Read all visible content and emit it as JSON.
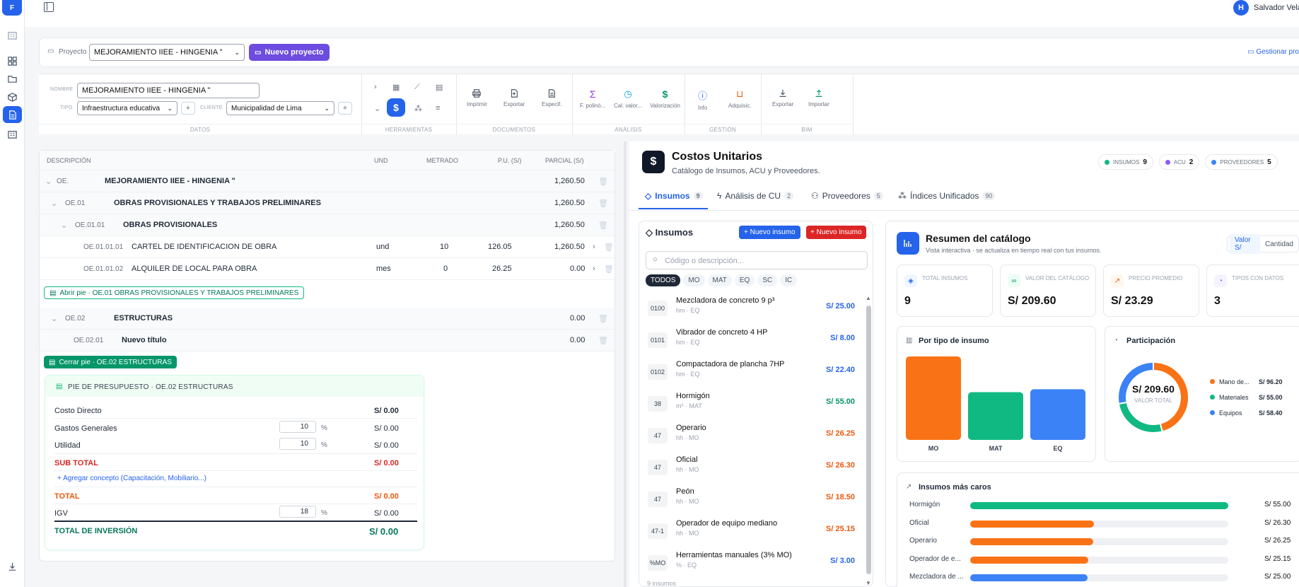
{
  "app": {
    "logo": "F",
    "user": "Salvador Velasquez"
  },
  "project": {
    "label": "Proyecto",
    "selected": "MEJORAMIENTO IIEE - HINGENIA \"",
    "new_button": "Nuevo proyecto",
    "manage_link": "Gestionar pro"
  },
  "datos": {
    "nombre_label": "NOMBRE",
    "nombre_value": "MEJORAMIENTO IIEE - HINGENIA \"",
    "tipo_label": "TIPO",
    "tipo_value": "Infraestructura educativa",
    "cliente_label": "CLIENTE",
    "cliente_value": "Municipalidad de Lima"
  },
  "sections": {
    "datos": "DATOS",
    "herramientas": "HERRAMIENTAS",
    "documentos": "DOCUMENTOS",
    "analisis": "ANÁLISIS",
    "gestion": "GESTIÓN",
    "bim": "BIM"
  },
  "tools": {
    "imprimir": "Imprimir",
    "exportar": "Exportar",
    "especif": "Especif.",
    "polinomica": "F. polinó...",
    "calvalor": "Cal. valor...",
    "valorizacion": "Valorización",
    "info": "Info",
    "adquisic": "Adquisic.",
    "bim_exportar": "Exportar",
    "bim_importar": "Importar"
  },
  "table": {
    "headers": {
      "desc": "DESCRIPCIÓN",
      "und": "UND",
      "metrado": "METRADO",
      "pu": "P.U. (S/)",
      "parcial": "PARCIAL (S/)"
    },
    "rows": [
      {
        "code": "OE.",
        "desc": "MEJORAMIENTO IIEE - HINGENIA \"",
        "und": "",
        "metrado": "",
        "pu": "",
        "parcial": "1,260.50"
      },
      {
        "code": "OE.01",
        "desc": "OBRAS PROVISIONALES Y TRABAJOS PRELIMINARES",
        "und": "",
        "metrado": "",
        "pu": "",
        "parcial": "1,260.50"
      },
      {
        "code": "OE.01.01",
        "desc": "OBRAS PROVISIONALES",
        "und": "",
        "metrado": "",
        "pu": "",
        "parcial": "1,260.50"
      },
      {
        "code": "OE.01.01.01",
        "desc": "CARTEL DE IDENTIFICACION DE OBRA",
        "und": "und",
        "metrado": "10",
        "pu": "126.05",
        "parcial": "1,260.50"
      },
      {
        "code": "OE.01.01.02",
        "desc": "ALQUILER DE LOCAL PARA OBRA",
        "und": "mes",
        "metrado": "0",
        "pu": "26.25",
        "parcial": "0.00"
      },
      {
        "code": "OE.02",
        "desc": "ESTRUCTURAS",
        "und": "",
        "metrado": "",
        "pu": "",
        "parcial": "0.00"
      },
      {
        "code": "OE.02.01",
        "desc": "Nuevo título",
        "und": "",
        "metrado": "",
        "pu": "",
        "parcial": "0.00"
      }
    ],
    "open_pie": "Abrir pie · OE.01 OBRAS PROVISIONALES Y TRABAJOS PRELIMINARES",
    "close_pie": "Cerrar pie · OE.02 ESTRUCTURAS"
  },
  "pie": {
    "title": "PIE DE PRESUPUESTO · OE.02 ESTRUCTURAS",
    "costo_directo": "Costo Directo",
    "costo_directo_v": "S/ 0.00",
    "gg": "Gastos Generales",
    "gg_pct": "10",
    "gg_v": "S/ 0.00",
    "util": "Utilidad",
    "util_pct": "10",
    "util_v": "S/ 0.00",
    "subtotal": "SUB TOTAL",
    "subtotal_v": "S/ 0.00",
    "agregar": "Agregar concepto (Capacitación, Mobiliario...)",
    "total": "TOTAL",
    "total_v": "S/ 0.00",
    "igv": "IGV",
    "igv_pct": "18",
    "igv_v": "S/ 0.00",
    "inversion": "TOTAL DE INVERSIÓN",
    "inversion_v": "S/ 0.00",
    "pct": "%"
  },
  "costos": {
    "title": "Costos Unitarios",
    "subtitle": "Catálogo de Insumos, ACU y Proveedores.",
    "pills": [
      {
        "label": "INSUMOS",
        "value": "9",
        "color": "#10b981"
      },
      {
        "label": "ACU",
        "value": "2",
        "color": "#8b5cf6"
      },
      {
        "label": "PROVEEDORES",
        "value": "5",
        "color": "#3b82f6"
      }
    ],
    "tabs": [
      {
        "label": "Insumos",
        "count": "9"
      },
      {
        "label": "Análisis de CU",
        "count": "2"
      },
      {
        "label": "Proveedores",
        "count": "5"
      },
      {
        "label": "Índices Unificados",
        "count": "90"
      }
    ]
  },
  "insumos": {
    "title": "Insumos",
    "new1": "Nuevo insumo",
    "new2": "Nuevo insumo",
    "search_placeholder": "Código o descripción...",
    "filters": [
      "TODOS",
      "MO",
      "MAT",
      "EQ",
      "SC",
      "IC"
    ],
    "items": [
      {
        "code": "0100",
        "name": "Mezcladora de concreto 9 p³",
        "sub": "hm · EQ",
        "price": "S/ 25.00",
        "color": "#2563eb"
      },
      {
        "code": "0101",
        "name": "Vibrador de concreto 4 HP",
        "sub": "hm · EQ",
        "price": "S/ 8.00",
        "color": "#2563eb"
      },
      {
        "code": "0102",
        "name": "Compactadora de plancha 7HP",
        "sub": "hm · EQ",
        "price": "S/ 22.40",
        "color": "#2563eb"
      },
      {
        "code": "38",
        "name": "Hormigón",
        "sub": "m³ · MAT",
        "price": "S/ 55.00",
        "color": "#059669"
      },
      {
        "code": "47",
        "name": "Operario",
        "sub": "hh · MO",
        "price": "S/ 26.25",
        "color": "#ea580c"
      },
      {
        "code": "47",
        "name": "Oficial",
        "sub": "hh · MO",
        "price": "S/ 26.30",
        "color": "#ea580c"
      },
      {
        "code": "47",
        "name": "Peón",
        "sub": "hh · MO",
        "price": "S/ 18.50",
        "color": "#ea580c"
      },
      {
        "code": "47-1",
        "name": "Operador de equipo mediano",
        "sub": "hh · MO",
        "price": "S/ 25.15",
        "color": "#ea580c"
      },
      {
        "code": "%MO",
        "name": "Herramientas manuales (3% MO)",
        "sub": "% · EQ",
        "price": "S/ 3.00",
        "color": "#2563eb"
      }
    ],
    "footer": "9 insumos"
  },
  "resumen": {
    "title": "Resumen del catálogo",
    "subtitle": "Vista interactiva · se actualiza en tiempo real con tus insumos.",
    "toggle_valor": "Valor S/",
    "toggle_cantidad": "Cantidad",
    "stats": [
      {
        "label": "TOTAL INSUMOS",
        "value": "9"
      },
      {
        "label": "VALOR DEL CATÁLOGO",
        "value": "S/ 209.60"
      },
      {
        "label": "PRECIO PROMEDIO",
        "value": "S/ 23.29"
      },
      {
        "label": "TIPOS CON DATOS",
        "value": "3"
      }
    ],
    "bar_title": "Por tipo de insumo",
    "part_title": "Participación",
    "donut_value": "S/ 209.60",
    "donut_label": "VALOR TOTAL",
    "legend": [
      {
        "name": "Mano de...",
        "value": "S/ 96.20",
        "color": "#f97316"
      },
      {
        "name": "Materiales",
        "value": "S/ 55.00",
        "color": "#10b981"
      },
      {
        "name": "Equipos",
        "value": "S/ 58.40",
        "color": "#3b82f6"
      }
    ],
    "caros_title": "Insumos más caros",
    "caros": [
      {
        "name": "Hormigón",
        "value": "S/ 55.00",
        "num": 55.0,
        "color": "#10b981"
      },
      {
        "name": "Oficial",
        "value": "S/ 26.30",
        "num": 26.3,
        "color": "#f97316"
      },
      {
        "name": "Operario",
        "value": "S/ 26.25",
        "num": 26.25,
        "color": "#f97316"
      },
      {
        "name": "Operador de e...",
        "value": "S/ 25.15",
        "num": 25.15,
        "color": "#f97316"
      },
      {
        "name": "Mezcladora de ...",
        "value": "S/ 25.00",
        "num": 25.0,
        "color": "#3b82f6"
      }
    ]
  },
  "chart_data": {
    "type": "bar",
    "title": "Por tipo de insumo",
    "categories": [
      "MO",
      "MAT",
      "EQ"
    ],
    "values": [
      96.2,
      55.0,
      58.4
    ],
    "colors": [
      "#f97316",
      "#10b981",
      "#3b82f6"
    ]
  }
}
